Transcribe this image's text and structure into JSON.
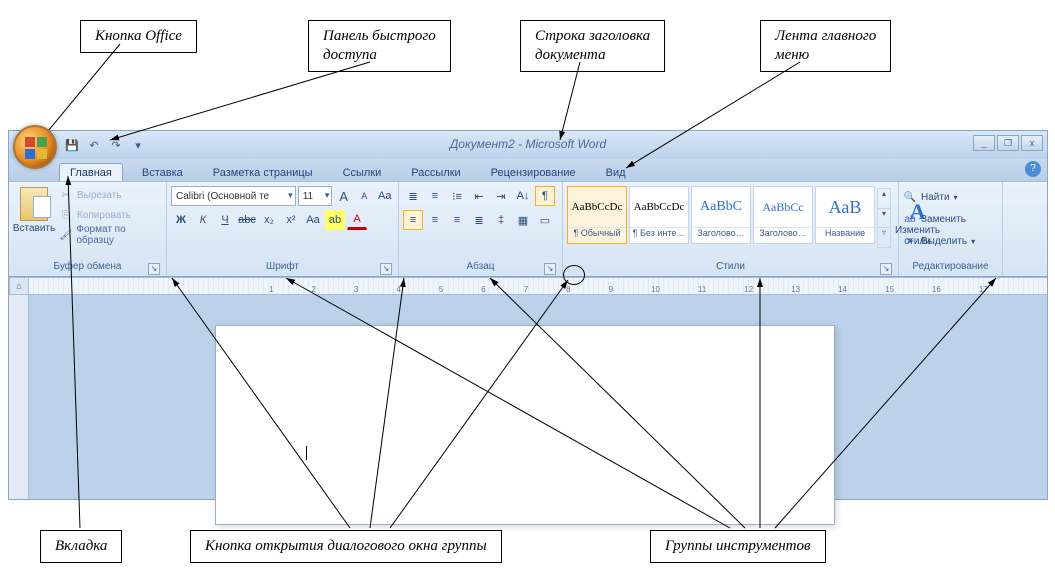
{
  "callouts": {
    "office_button": "Кнопка Office",
    "qat": "Панель быстрого\nдоступа",
    "title_row": "Строка заголовка\nдокумента",
    "ribbon": "Лента главного\nменю",
    "tab": "Вкладка",
    "dlg_launcher": "Кнопка открытия диалогового окна группы",
    "groups": "Группы инструментов"
  },
  "titlebar": {
    "document_title": "Документ2 - Microsoft Word",
    "qat_icons": [
      "save-icon",
      "undo-icon",
      "redo-icon",
      "qat-menu-icon"
    ],
    "window_controls": {
      "minimize": "_",
      "restore": "❐",
      "close": "x"
    }
  },
  "tabs": [
    {
      "label": "Главная",
      "active": true
    },
    {
      "label": "Вставка",
      "active": false
    },
    {
      "label": "Разметка страницы",
      "active": false
    },
    {
      "label": "Ссылки",
      "active": false
    },
    {
      "label": "Рассылки",
      "active": false
    },
    {
      "label": "Рецензирование",
      "active": false
    },
    {
      "label": "Вид",
      "active": false
    }
  ],
  "help_glyph": "?",
  "ribbon_groups": {
    "clipboard": {
      "label": "Буфер обмена",
      "paste": "Вставить",
      "cut": "Вырезать",
      "copy": "Копировать",
      "format_painter": "Формат по образцу"
    },
    "font": {
      "label": "Шрифт",
      "font_name": "Calibri (Основной те",
      "font_size": "11",
      "grow": "A",
      "shrink": "A",
      "clear_fmt": "Aa",
      "bold": "Ж",
      "italic": "К",
      "underline": "Ч",
      "strike": "abc",
      "subscript": "x₂",
      "superscript": "x²",
      "change_case": "Aa",
      "highlight": "ab",
      "font_color": "A"
    },
    "paragraph": {
      "label": "Абзац",
      "icons_row1": [
        "bullets",
        "numbering",
        "multilevel",
        "dec-indent",
        "inc-indent",
        "sort",
        "show-marks"
      ],
      "icons_row2": [
        "align-left",
        "align-center",
        "align-right",
        "justify",
        "line-spacing",
        "shading",
        "borders"
      ],
      "glyphs_row1": [
        "≣",
        "≡",
        "⁝≡",
        "⇤",
        "⇥",
        "A↓",
        "¶"
      ],
      "glyphs_row2": [
        "≡",
        "≡",
        "≡",
        "≣",
        "‡",
        "▦",
        "▭"
      ]
    },
    "styles": {
      "label": "Стили",
      "items": [
        {
          "preview": "AaBbCcDc",
          "name": "¶ Обычный",
          "selected": true,
          "size": 11,
          "color": "#000"
        },
        {
          "preview": "AaBbCcDc",
          "name": "¶ Без инте…",
          "selected": false,
          "size": 11,
          "color": "#000"
        },
        {
          "preview": "AaBbC",
          "name": "Заголово…",
          "selected": false,
          "size": 14,
          "color": "#2a6ed3"
        },
        {
          "preview": "AaBbCc",
          "name": "Заголово…",
          "selected": false,
          "size": 12,
          "color": "#2a6ed3"
        },
        {
          "preview": "АаВ",
          "name": "Название",
          "selected": false,
          "size": 18,
          "color": "#2a6ed3"
        }
      ],
      "change_styles": "Изменить\nстили",
      "change_styles_glyph": "A"
    },
    "editing": {
      "label": "Редактирование",
      "find": "Найти",
      "replace": "Заменить",
      "select": "Выделить"
    }
  },
  "ruler_marks": [
    "1",
    "2",
    "3",
    "4",
    "5",
    "6",
    "7",
    "8",
    "9",
    "10",
    "11",
    "12",
    "13",
    "14",
    "15",
    "16",
    "17"
  ],
  "ruler_corner": "⌂"
}
